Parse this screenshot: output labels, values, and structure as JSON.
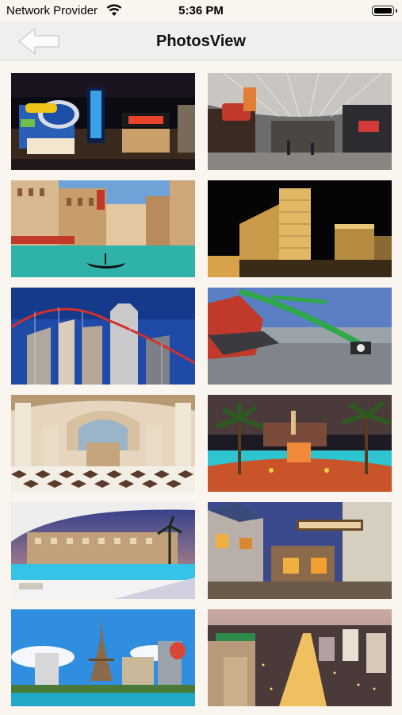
{
  "status": {
    "carrier": "Network Provider",
    "time": "5:36 PM",
    "wifi_icon": "wifi-icon",
    "battery_icon": "battery-icon"
  },
  "nav": {
    "title": "PhotosView",
    "back_icon": "back-arrow-icon"
  },
  "photos": [
    {
      "scene": "casino-interior-showtime"
    },
    {
      "scene": "covered-street-canopy"
    },
    {
      "scene": "venetian-canal-gondola"
    },
    {
      "scene": "resort-tower-night"
    },
    {
      "scene": "skyline-rollercoaster"
    },
    {
      "scene": "rooftop-swing-ride"
    },
    {
      "scene": "ornate-lobby-checker-floor"
    },
    {
      "scene": "palm-pool-night"
    },
    {
      "scene": "villa-pool-sunset"
    },
    {
      "scene": "provence-village-street"
    },
    {
      "scene": "eiffel-replica-lake"
    },
    {
      "scene": "strip-aerial-dusk"
    }
  ]
}
